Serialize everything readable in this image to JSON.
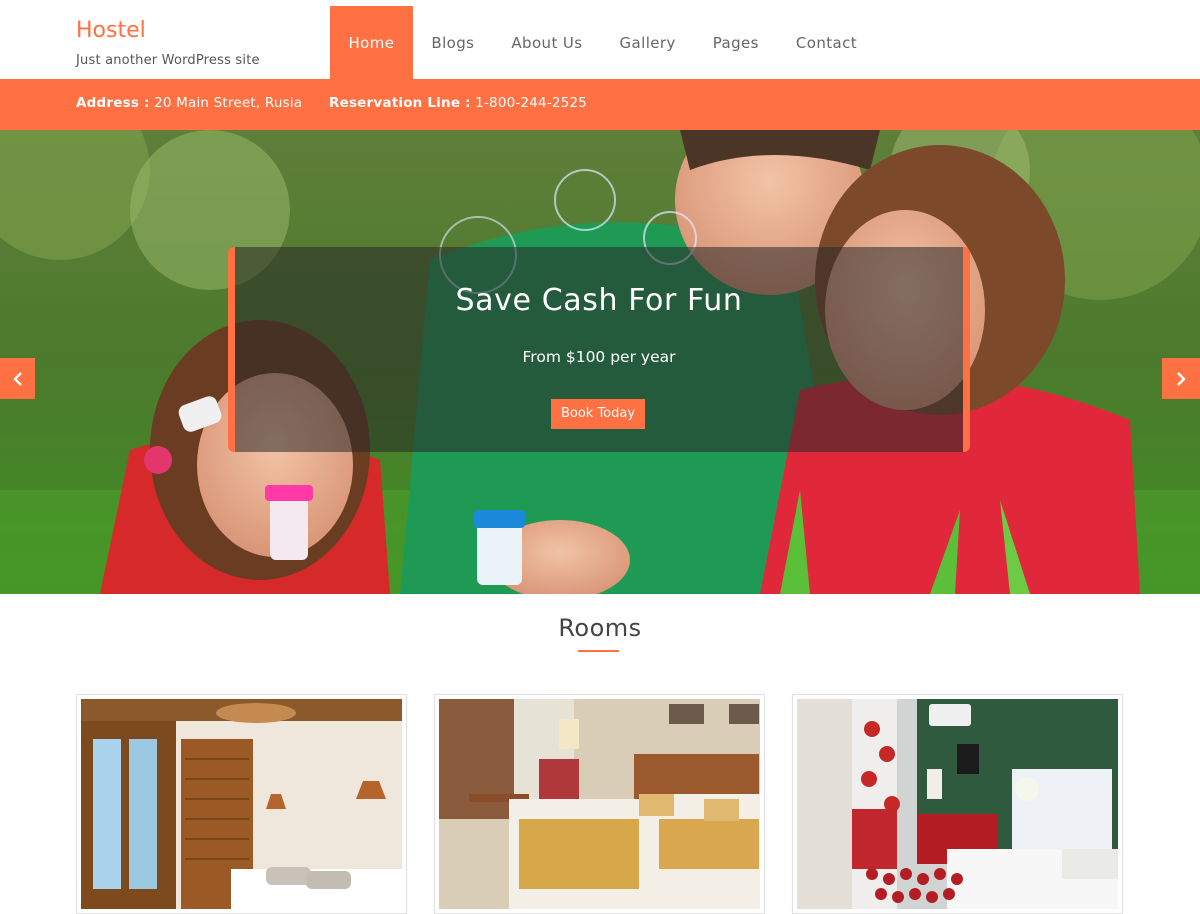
{
  "site": {
    "title": "Hostel",
    "tagline": "Just another WordPress site"
  },
  "nav": {
    "items": [
      {
        "label": "Home",
        "active": true
      },
      {
        "label": "Blogs",
        "active": false
      },
      {
        "label": "About Us",
        "active": false
      },
      {
        "label": "Gallery",
        "active": false
      },
      {
        "label": "Pages",
        "active": false
      },
      {
        "label": "Contact",
        "active": false
      }
    ]
  },
  "infobar": {
    "address_label": "Address :",
    "address_value": "20 Main Street, Rusia",
    "reservation_label": "Reservation Line :",
    "reservation_value": "1-800-244-2525"
  },
  "hero": {
    "title": "Save Cash For Fun",
    "subtitle": "From $100 per year",
    "button_label": "Book Today",
    "prev_icon": "chevron-left-icon",
    "next_icon": "chevron-right-icon"
  },
  "rooms": {
    "section_title": "Rooms",
    "cards": [
      {
        "image": "room-photo-1"
      },
      {
        "image": "room-photo-2"
      },
      {
        "image": "room-photo-3"
      }
    ]
  },
  "colors": {
    "accent": "#ff7043",
    "text": "#666666",
    "overlay": "rgba(40,40,40,0.55)"
  }
}
